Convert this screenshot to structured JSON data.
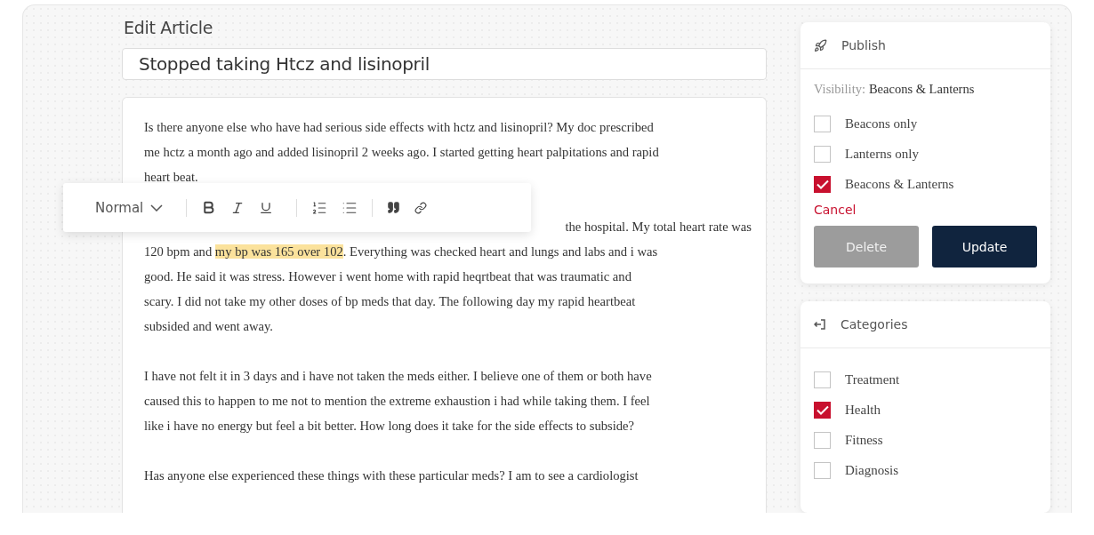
{
  "page": {
    "title": "Edit Article"
  },
  "article_title": {
    "value": "Stopped taking Htcz and lisinopril"
  },
  "toolbar": {
    "format": "Normal"
  },
  "editor": {
    "paragraphs": [
      {
        "kind": "plain",
        "text": "Is there anyone else who have had serious side effects with hctz and lisinopril? My doc prescribed\nme hctz a month ago and added lisinopril 2 weeks ago. I started getting heart palpitations and rapid\nheart beat."
      },
      {
        "kind": "covered",
        "visible_tail": "the hospital. My total heart rate was",
        "segments": [
          {
            "text": "120 bpm and ",
            "highlighted": false
          },
          {
            "text": "my bp was 165 over 102",
            "highlighted": true
          },
          {
            "text": ". Everything was checked heart and lungs and labs and i was\ngood. He said it was stress. However i went home with rapid heqrtbeat that was traumatic and\nscary. I did not take my other doses of bp meds that day. The following day my rapid heartbeat\nsubsided and went away.",
            "highlighted": false
          }
        ]
      },
      {
        "kind": "plain",
        "text": "I have not felt it in 3 days and i have not taken the meds either. I believe one of them or both have\ncaused this to happen to me not to mention the extreme exhaustion i had while taking them. I feel\nlike i have no energy but feel a bit better. How long does it take for the side effects to subside?"
      },
      {
        "kind": "plain",
        "text": "Has anyone else experienced these things with these particular meds? I am to see a cardiologist"
      }
    ]
  },
  "publish": {
    "title": "Publish",
    "visibility_label": "Visibility:",
    "visibility_value": "Beacons & Lanterns",
    "options": [
      {
        "label": "Beacons only",
        "checked": false
      },
      {
        "label": "Lanterns only",
        "checked": false
      },
      {
        "label": "Beacons & Lanterns",
        "checked": true
      }
    ],
    "cancel": "Cancel",
    "buttons": [
      {
        "label": "Delete",
        "kind": "secondary"
      },
      {
        "label": "Update",
        "kind": "primary"
      }
    ]
  },
  "categories": {
    "title": "Categories",
    "items": [
      {
        "label": "Treatment",
        "checked": false
      },
      {
        "label": "Health",
        "checked": true
      },
      {
        "label": "Fitness",
        "checked": false
      },
      {
        "label": "Diagnosis",
        "checked": false
      }
    ]
  }
}
